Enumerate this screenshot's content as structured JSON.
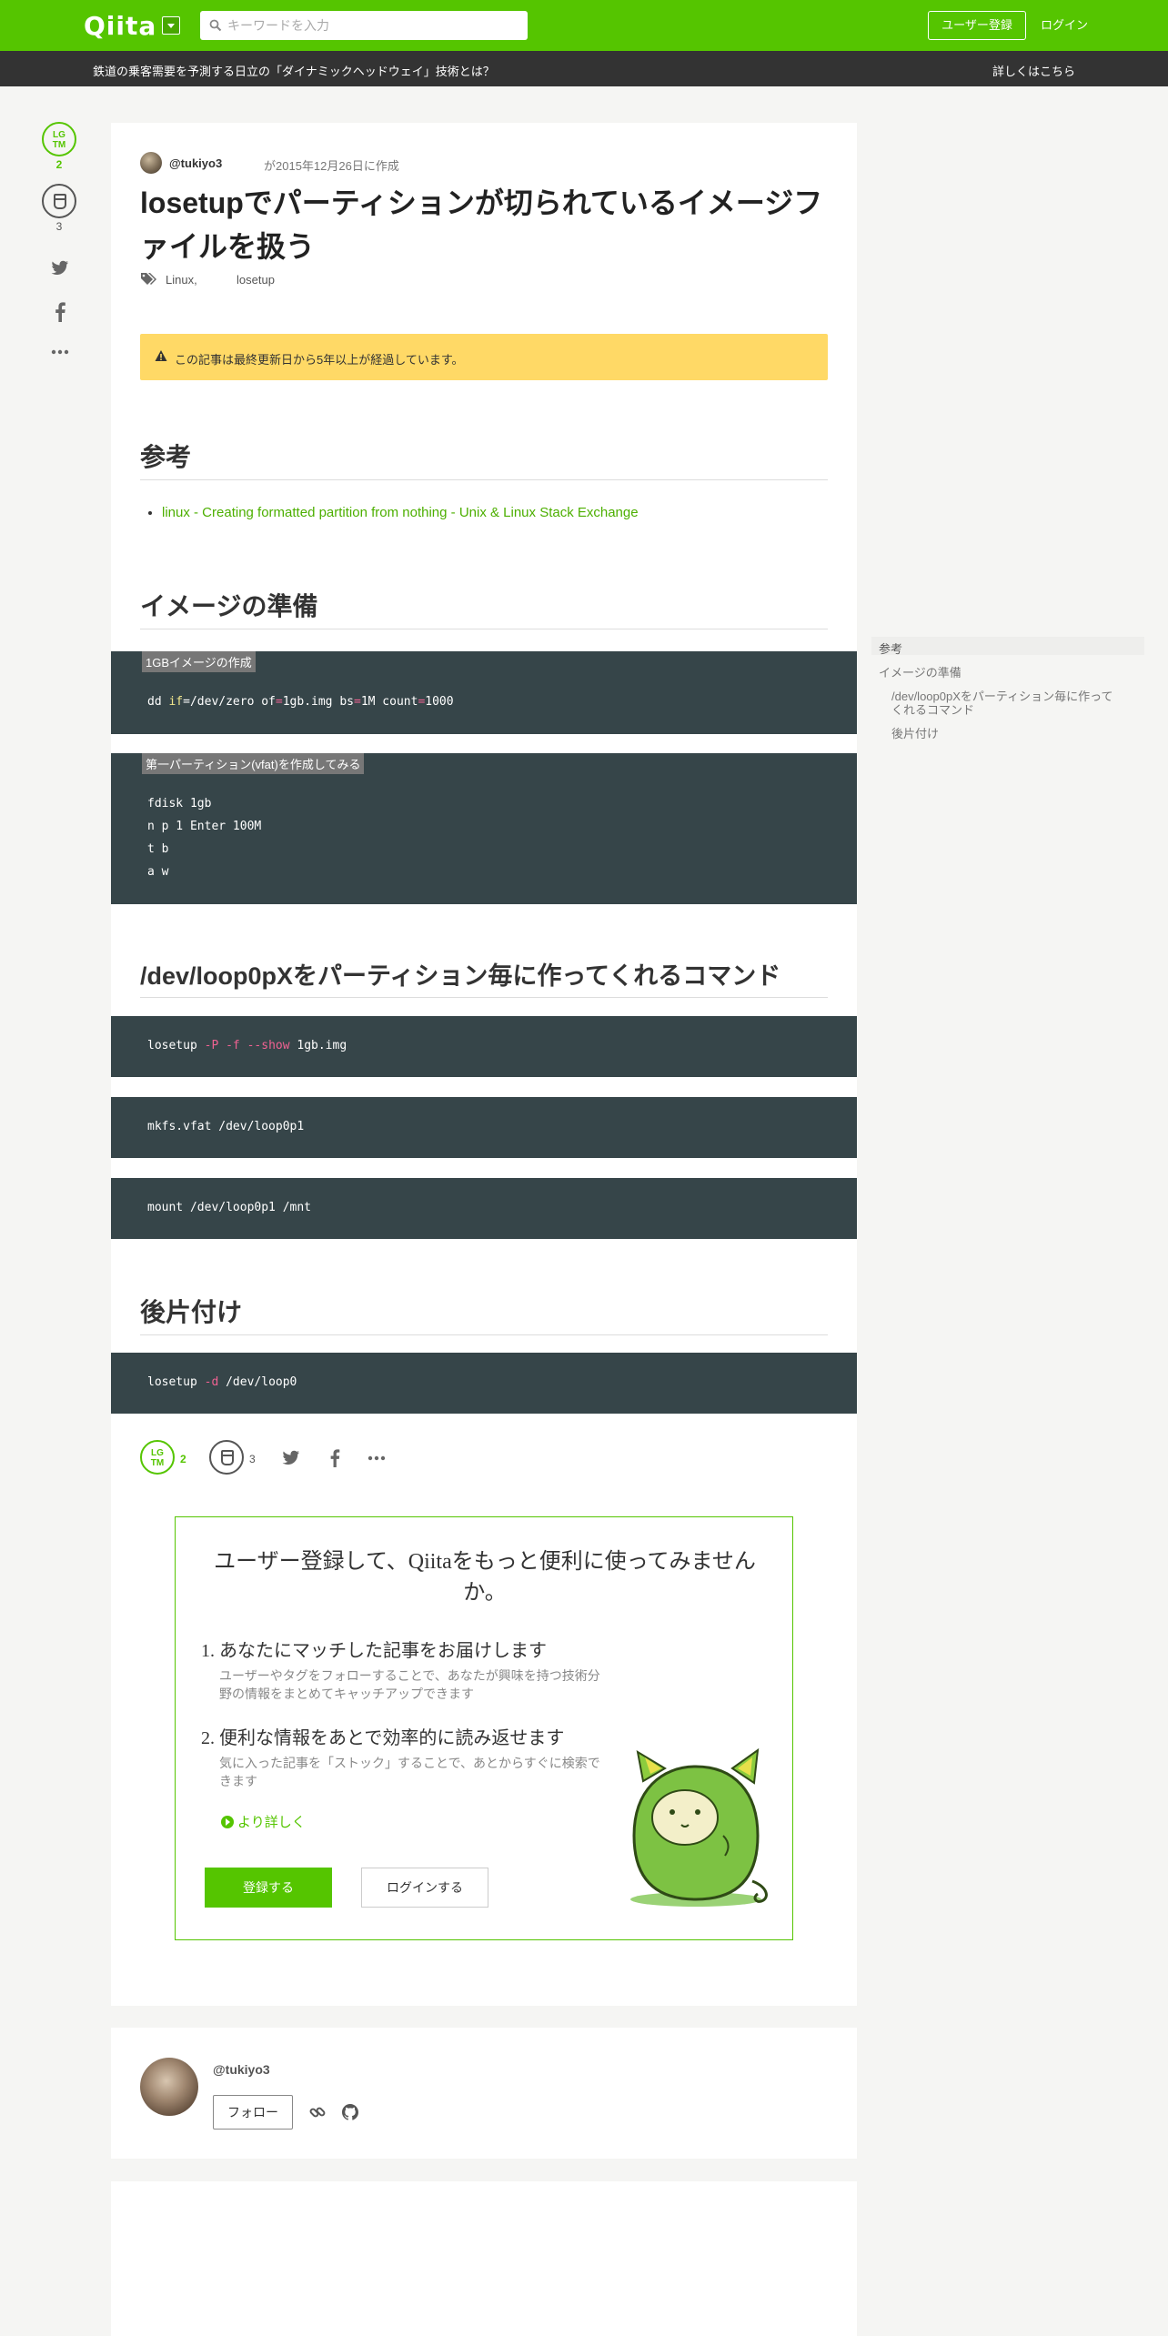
{
  "header": {
    "logo": "Qiita",
    "search_placeholder": "キーワードを入力",
    "signup": "ユーザー登録",
    "login": "ログイン"
  },
  "banner": {
    "text": "鉄道の乗客需要を予測する日立の「ダイナミックヘッドウェイ」技術とは？",
    "link": "詳しくはこちら"
  },
  "side_actions": {
    "lgtm_icon_text_1": "LG",
    "lgtm_icon_text_2": "TM",
    "lgtm_count": "2",
    "stock_count": "3"
  },
  "article": {
    "author": "@tukiyo3",
    "created": "が2015年12月26日に作成",
    "title": "losetupでパーティションが切られているイメージファイルを扱う",
    "tags": [
      "Linux,",
      "losetup"
    ],
    "alert": "この記事は最終更新日から5年以上が経過しています。",
    "sections": {
      "ref_heading": "参考",
      "ref_link": "linux - Creating formatted partition from nothing - Unix & Linux Stack Exchange",
      "prep_heading": "イメージの準備",
      "loop_heading": "/dev/loop0pXをパーティション毎に作ってくれるコマンド",
      "cleanup_heading": "後片付け"
    },
    "code": {
      "label1": "1GBイメージの作成",
      "dd_a": "dd ",
      "dd_if": "if",
      "dd_b": "=/dev/zero of",
      "dd_c": "=",
      "dd_d": "1gb.img bs",
      "dd_e": "=",
      "dd_f": "1M count",
      "dd_g": "=",
      "dd_h": "1000",
      "label2": "第一パーティション(vfat)を作成してみる",
      "fdisk1": "fdisk 1gb",
      "fdisk2": "n p 1 Enter 100M",
      "fdisk3": "t b",
      "fdisk4": "a w",
      "losetup_a": "losetup ",
      "losetup_b": "-P -f --show",
      "losetup_c": " 1gb.img",
      "mkfs": "mkfs.vfat /dev/loop0p1",
      "mount": "mount /dev/loop0p1 /mnt",
      "detach_a": "losetup ",
      "detach_b": "-d",
      "detach_c": " /dev/loop0"
    }
  },
  "bottom_actions": {
    "lgtm_count": "2",
    "stock_count": "3"
  },
  "signup_box": {
    "title": "ユーザー登録して、Qiitaをもっと便利に使ってみませんか。",
    "item1_title": "1. あなたにマッチした記事をお届けします",
    "item1_desc": "ユーザーやタグをフォローすることで、あなたが興味を持つ技術分野の情報をまとめてキャッチアップできます",
    "item2_title": "2. 便利な情報をあとで効率的に読み返せます",
    "item2_desc": "気に入った記事を「ストック」することで、あとからすぐに検索できます",
    "more": "より詳しく",
    "register": "登録する",
    "login": "ログインする"
  },
  "author_card": {
    "name": "@tukiyo3",
    "follow": "フォロー"
  },
  "toc": {
    "items": [
      "参考",
      "イメージの準備",
      "/dev/loop0pXをパーティション毎に作って",
      "くれるコマンド",
      "後片付け"
    ]
  },
  "colors": {
    "brand": "#55c500",
    "code_bg": "#364549",
    "alert_bg": "#ffd966"
  }
}
